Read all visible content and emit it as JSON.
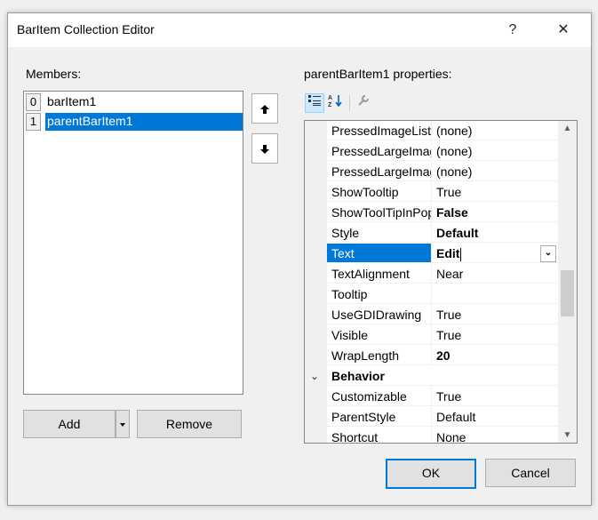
{
  "window": {
    "title": "BarItem Collection Editor",
    "help_glyph": "?",
    "close_glyph": "✕"
  },
  "members": {
    "label": "Members:",
    "items": [
      {
        "index": "0",
        "name": "barItem1"
      },
      {
        "index": "1",
        "name": "parentBarItem1",
        "selected": true
      }
    ]
  },
  "buttons": {
    "add": "Add",
    "remove": "Remove",
    "ok": "OK",
    "cancel": "Cancel",
    "up_glyph": "🡅",
    "down_glyph": "🡇"
  },
  "properties": {
    "label": "parentBarItem1 properties:",
    "rows": [
      {
        "name": "PressedImageList",
        "value": "(none)"
      },
      {
        "name": "PressedLargeImageIndex",
        "value": "(none)"
      },
      {
        "name": "PressedLargeImageList",
        "value": "(none)"
      },
      {
        "name": "ShowTooltip",
        "value": "True"
      },
      {
        "name": "ShowToolTipInPopup",
        "value": "False"
      },
      {
        "name": "Style",
        "value": "Default"
      },
      {
        "name": "Text",
        "value": "Edit"
      },
      {
        "name": "TextAlignment",
        "value": "Near"
      },
      {
        "name": "Tooltip",
        "value": ""
      },
      {
        "name": "UseGDIDrawing",
        "value": "True"
      },
      {
        "name": "Visible",
        "value": "True"
      },
      {
        "name": "WrapLength",
        "value": "20"
      },
      {
        "name": "Behavior",
        "value": ""
      },
      {
        "name": "Customizable",
        "value": "True"
      },
      {
        "name": "ParentStyle",
        "value": "Default"
      },
      {
        "name": "Shortcut",
        "value": "None"
      }
    ]
  },
  "colors": {
    "selection": "#0078d7",
    "accent": "#0078d7"
  }
}
